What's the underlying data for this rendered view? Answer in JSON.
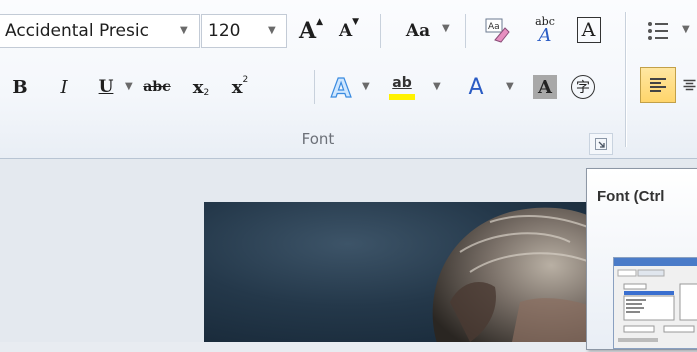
{
  "font_group": {
    "font_name": "Accidental Presic",
    "font_size": "120",
    "label": "Font",
    "case_button": "Aa",
    "grow_font": "A",
    "shrink_font": "A",
    "bold": "B",
    "italic": "I",
    "underline": "U",
    "strikethrough": "abc",
    "subscript": "x",
    "superscript": "x",
    "font_color": "A",
    "char_shading": "A",
    "enclose_char": "字",
    "phonetic_top": "abc",
    "phonetic_bottom": "A",
    "char_border": "A",
    "highlight": "ab"
  },
  "tooltip": {
    "title": "Font (Ctrl"
  },
  "colors": {
    "accent_highlight": "#fff200",
    "font_color": "#2b5cc4",
    "active_button": "#ffd56b"
  }
}
